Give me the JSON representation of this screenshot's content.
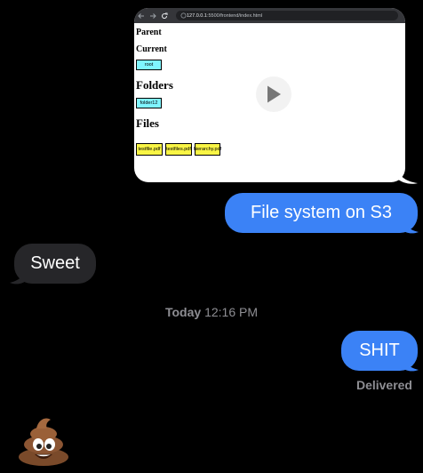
{
  "attachment": {
    "browser": {
      "url_host": "127.0.0.1",
      "url_path": ":5500/frontend/index.html"
    },
    "page": {
      "parent_heading": "Parent",
      "current_heading": "Current",
      "current_item": "root",
      "folders_heading": "Folders",
      "folder_item": "folder12",
      "files_heading": "Files",
      "files": [
        "testfile.pdf",
        "testfiles.pdf",
        "hierarchy.pdf"
      ]
    }
  },
  "messages": {
    "sent_1": "File system on S3",
    "received_1": "Sweet",
    "timestamp_day": "Today",
    "timestamp_time": "12:16 PM",
    "sent_2": "SHIT",
    "status": "Delivered"
  },
  "colors": {
    "sent_bubble": "#3b82f6",
    "received_bubble": "#262629",
    "folder_box": "#7ff5ff",
    "file_box": "#f9f545"
  },
  "icons": [
    "back-arrow-icon",
    "forward-arrow-icon",
    "reload-icon",
    "info-icon",
    "play-icon",
    "poop-emoji-icon"
  ]
}
